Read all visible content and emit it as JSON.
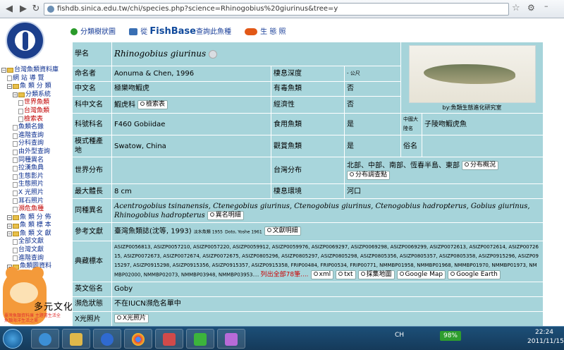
{
  "browser": {
    "url": "fishdb.sinica.edu.tw/chi/species.php?science=Rhinogobius%20giurinus&tree=y"
  },
  "sidebar": {
    "logo_text": "臺灣魚類資料庫",
    "tree": [
      {
        "label": "台灣魚類資料庫",
        "kind": "folder",
        "indent": 0
      },
      {
        "label": "網 站 導 覽",
        "kind": "page",
        "indent": 1
      },
      {
        "label": "魚 類 分 類",
        "kind": "folder",
        "indent": 1
      },
      {
        "label": "分類系統",
        "kind": "folder",
        "indent": 2
      },
      {
        "label": "世界魚類",
        "kind": "page",
        "indent": 3
      },
      {
        "label": "台灣魚類",
        "kind": "page",
        "indent": 3
      },
      {
        "label": "檢索表",
        "kind": "page",
        "indent": 3
      },
      {
        "label": "魚類名錄",
        "kind": "page",
        "indent": 2
      },
      {
        "label": "進階查詢",
        "kind": "page",
        "indent": 2
      },
      {
        "label": "分科查詢",
        "kind": "page",
        "indent": 2
      },
      {
        "label": "由外型查詢",
        "kind": "page",
        "indent": 2
      },
      {
        "label": "同種異名",
        "kind": "page",
        "indent": 2
      },
      {
        "label": "拉漢魚典",
        "kind": "page",
        "indent": 2
      },
      {
        "label": "生態影片",
        "kind": "page",
        "indent": 2
      },
      {
        "label": "生態照片",
        "kind": "page",
        "indent": 2
      },
      {
        "label": "X 光照片",
        "kind": "page",
        "indent": 2
      },
      {
        "label": "耳石照片",
        "kind": "page",
        "indent": 2
      },
      {
        "label": "瀕危魚種",
        "kind": "page",
        "indent": 2
      },
      {
        "label": "魚 類 分 佈",
        "kind": "folder",
        "indent": 1
      },
      {
        "label": "魚 類 標 本",
        "kind": "folder",
        "indent": 1
      },
      {
        "label": "魚 類 文 獻",
        "kind": "folder",
        "indent": 1
      },
      {
        "label": "全部文獻",
        "kind": "page",
        "indent": 2
      },
      {
        "label": "台灣文獻",
        "kind": "page",
        "indent": 2
      },
      {
        "label": "進階查詢",
        "kind": "page",
        "indent": 2
      },
      {
        "label": "魚類圖資料",
        "kind": "folder",
        "indent": 1
      }
    ],
    "mascot_stamp": "臺灣魚類資料庫 主題書生活全 魚類海洋生活之美",
    "mascot_calligraphy": "多元文化臺灣"
  },
  "toplinks": [
    {
      "label": "分類樹狀圖",
      "icon": "clover-icon"
    },
    {
      "label_prefix": "從 ",
      "label_brand": "FishBase",
      "label_suffix": "查詢此魚種",
      "icon": "book-icon"
    },
    {
      "label": "生 態 照",
      "icon": "clownfish-icon"
    }
  ],
  "species": {
    "labels": {
      "sci_name": "學名",
      "author": "命名者",
      "chinese_name": "中文名",
      "family_chinese": "科中文名",
      "family_code": "科號科名",
      "type_locality": "模式種產地",
      "world_distribution": "世界分布",
      "max_length": "最大體長",
      "synonyms": "同種異名",
      "references": "參考文獻",
      "specimens": "典藏標本",
      "english_name": "英文俗名",
      "endangered": "瀕危狀態",
      "xray": "X光照片",
      "habitat_depth": "棲息深度",
      "venomous": "有毒魚類",
      "economic": "經濟性",
      "edible": "食用魚類",
      "aquarium": "觀賞魚類",
      "taiwan_distribution": "台灣分布",
      "habitat_env": "棲息環境",
      "dialect": "中國大陸名",
      "common_name": "俗名"
    },
    "sci_name": "Rhinogobius giurinus",
    "author": "Aonuma & Chen, 1996",
    "chinese_name": "極樂吻鰕虎",
    "family_chinese": "鰕虎科",
    "family_code": "F460 Gobiidae",
    "type_locality": "Swatow, China",
    "max_length": "8 cm",
    "synonyms": "Acentrogobius tsinanensis, Ctenegobius giurinus, Ctenogobius giurinus, Ctenogobius hadropterus, Gobius giurinus, Rhinogobius hadropterus",
    "reference_main": "臺灣魚類誌(沈等, 1993)",
    "reference_small_1": "淡水魚類 1955",
    "reference_small_2": "Doto, Yoshe 1961",
    "specimens_list": "ASIZP0056813, ASIZP0057210, ASIZP0057220, ASIZP0059912, ASIZP0059976, ASIZP0069297, ASIZP0069298, ASIZP0069299, ASIZP0072613, ASIZP0072614, ASIZP0072615, ASIZP0072673, ASIZP0072674, ASIZP0072675, ASIZP0805296, ASIZP0805297, ASIZP0805298, ASIZP0805356, ASIZP0805357, ASIZP0805358, ASIZP0915296, ASIZP0915297, ASIZP0915298, ASIZP0915356, ASIZP0915357, ASIZP0915358, FRIP00484, FRIP00534, FRIP00771, NMMBP01958, NMMBP01968, NMMBP01970, NMMBP01973, NMMBP02000, NMMBP02073, NMMBP03948, NMMBP03953....",
    "specimens_more": "列出全部78筆....",
    "english_name": "Goby",
    "endangered": "不在IUCN瀕危名單中",
    "habitat_depth": "- 公尺",
    "venomous": "否",
    "economic": "否",
    "edible": "是",
    "aquarium": "是",
    "taiwan_distribution": "北部、中部、南部、恆春半島、東部",
    "habitat_env": "河口",
    "dialect": "子陵吻鰕虎魚",
    "common_name": "",
    "photo_caption": "by:魚類生態進化研究室",
    "buttons": {
      "key": "檢索表",
      "distribution": "分布概況",
      "distribution_survey": "分布調查點",
      "synonyms": "異名明細",
      "literature": "文獻明細",
      "xml": "xml",
      "txt": "txt",
      "specimen_map": "採集地圖",
      "google_map": "Google Map",
      "google_earth": "Google Earth",
      "xray": "X光照片"
    }
  },
  "taskbar": {
    "battery": "98%",
    "locale": "CH",
    "time": "22:24",
    "date": "2011/11/15"
  },
  "colors": {
    "table_bg": "#a6d4da",
    "border": "#ffffff",
    "link": "#1a3f99",
    "highlight_red": "#cc0000"
  }
}
